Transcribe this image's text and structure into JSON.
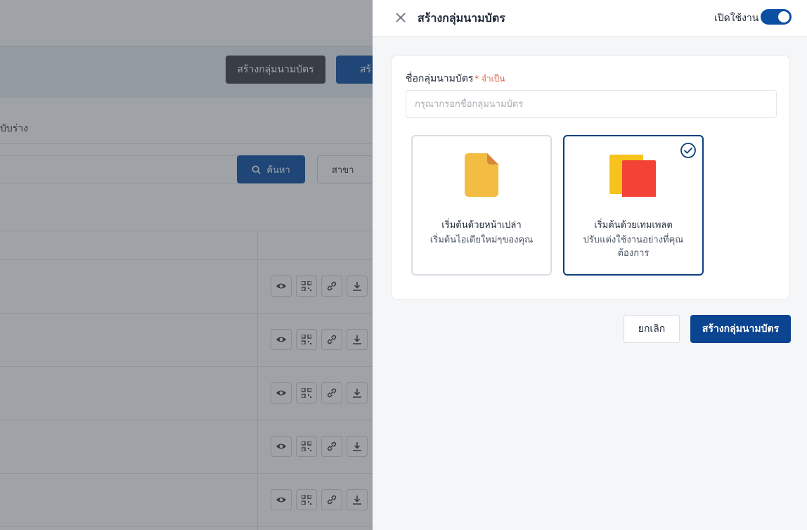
{
  "background": {
    "create_group_button": "สร้างกลุ่มนามบัตร",
    "blue_button_partial": "สร้",
    "tab_draft_partial": "บับร่าง",
    "search_button": "ค้นหา",
    "branch_filter": "สาขา",
    "row_count": 5
  },
  "drawer": {
    "title": "สร้างกลุ่มนามบัตร",
    "toggle_label": "เปิดใช้งาน",
    "toggle_on": true,
    "form": {
      "name_label": "ชื่อกลุ่มนามบัตร",
      "required_text": "* จำเป็น",
      "name_placeholder": "กรุณากรอกชื่อกลุ่มนามบัตร",
      "name_value": ""
    },
    "options": {
      "blank": {
        "title": "เริ่มต้นด้วยหน้าเปล่า",
        "subtitle": "เริ่มต้นไอเดียใหม่ๆของคุณ",
        "selected": false
      },
      "template": {
        "title": "เริ่มต้นด้วยเทมเพลต",
        "subtitle": "ปรับแต่งใช้งานอย่างที่คุณต้องการ",
        "selected": true
      }
    },
    "cancel_label": "ยกเลิก",
    "submit_label": "สร้างกลุ่มนามบัตร"
  },
  "colors": {
    "primary": "#0b4490",
    "file_icon": "#f2bd42",
    "template_yellow": "#f6c21b",
    "template_red": "#f44336",
    "required": "#e0674d"
  }
}
